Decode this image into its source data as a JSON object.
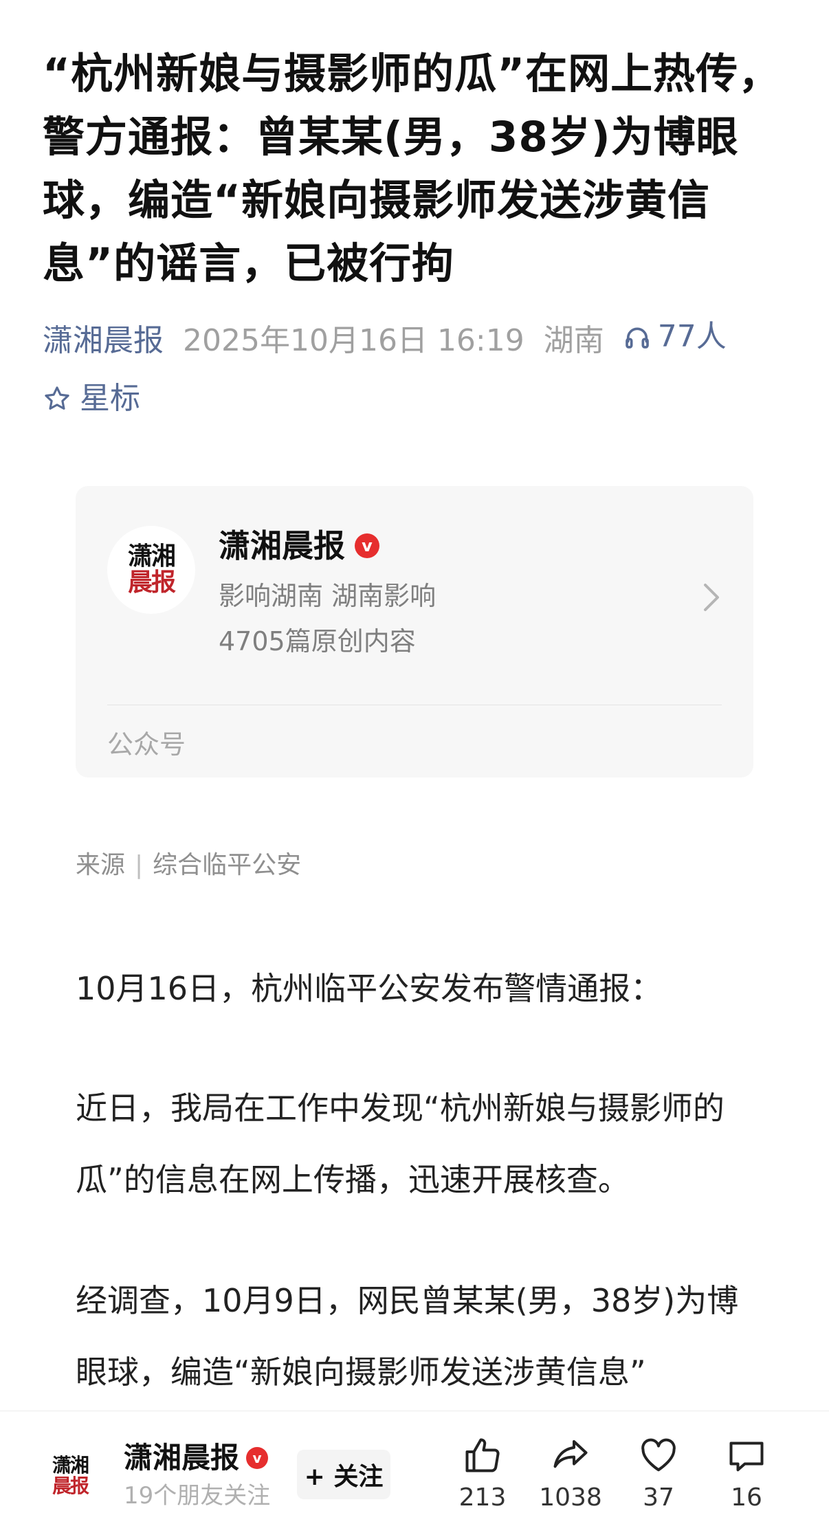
{
  "article": {
    "title": "“杭州新娘与摄影师的瓜”在网上热传，警方通报：曾某某(男，38岁)为博眼球，编造“新娘向摄影师发送涉黄信息”的谣言，已被行拘",
    "source": "潇湘晨报",
    "datetime": "2025年10月16日 16:19",
    "region": "湖南",
    "listeners": "77人",
    "star_label": "星标",
    "credit_label": "来源",
    "credit_value": "综合临平公安",
    "paragraphs": [
      "10月16日，杭州临平公安发布警情通报：",
      "近日，我局在工作中发现“杭州新娘与摄影师的瓜”的信息在网上传播，迅速开展核查。",
      "经调查，10月9日，网民曾某某(男，38岁)为博眼球，编造“新娘向摄影师发送涉黄信息”"
    ]
  },
  "account_card": {
    "logo_line1": "潇湘",
    "logo_line2": "晨报",
    "name": "潇湘晨报",
    "verified": "v",
    "slogan": "影响湖南 湖南影响",
    "original_count": "4705篇原创内容",
    "kind": "公众号"
  },
  "bottom_bar": {
    "logo_line1": "潇湘",
    "logo_line2": "晨报",
    "name": "潇湘晨报",
    "verified": "v",
    "friends_following": "19个朋友关注",
    "follow_label": "+ 关注",
    "actions": [
      {
        "icon": "thumbs-up-icon",
        "count": "213"
      },
      {
        "icon": "share-icon",
        "count": "1038"
      },
      {
        "icon": "heart-icon",
        "count": "37"
      },
      {
        "icon": "comment-icon",
        "count": "16"
      }
    ]
  },
  "colors": {
    "link_blue": "#576b95",
    "verified_red": "#e62e2e",
    "logo_red": "#c0252b"
  }
}
